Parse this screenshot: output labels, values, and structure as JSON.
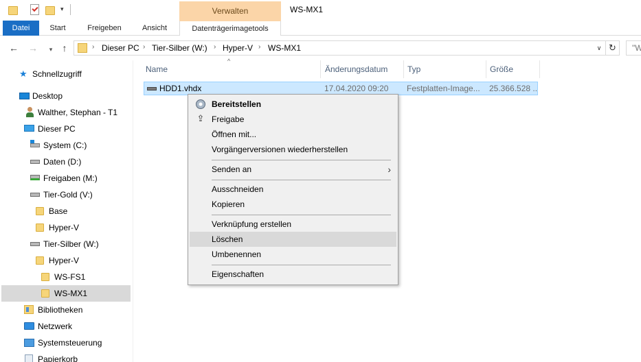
{
  "titlebar": {
    "contextual_tab_header": "Verwalten",
    "window_title": "WS-MX1",
    "qat_dropdown": "▾"
  },
  "ribbon": {
    "tabs": {
      "file": "Datei",
      "start": "Start",
      "share": "Freigeben",
      "view": "Ansicht",
      "disk_image_tools": "Datenträgerimagetools"
    },
    "accent_color": "#1a6ec5",
    "contextual_color": "#fbd5a8"
  },
  "addressbar": {
    "back": "←",
    "forward": "→",
    "recent": "▾",
    "up": "↑",
    "crumbs": [
      "Dieser PC",
      "Tier-Silber (W:)",
      "Hyper-V",
      "WS-MX1"
    ],
    "separator": "›",
    "dropdown": "∨",
    "refresh": "↻",
    "search_text": "\"W"
  },
  "nav": {
    "quick_access": "Schnellzugriff",
    "desktop": "Desktop",
    "user": "Walther, Stephan - T1",
    "this_pc": "Dieser PC",
    "system": "System (C:)",
    "data": "Daten (D:)",
    "shares": "Freigaben (M:)",
    "tier_gold": "Tier-Gold (V:)",
    "base": "Base",
    "hyperv_gold": "Hyper-V",
    "tier_silver": "Tier-Silber (W:)",
    "hyperv_silver": "Hyper-V",
    "ws_fs1": "WS-FS1",
    "ws_mx1": "WS-MX1",
    "libraries": "Bibliotheken",
    "network": "Netzwerk",
    "control_panel": "Systemsteuerung",
    "recycle_bin": "Papierkorb"
  },
  "filelist": {
    "sort_indicator": "^",
    "columns": {
      "name": "Name",
      "modified": "Änderungsdatum",
      "type": "Typ",
      "size": "Größe"
    },
    "rows": [
      {
        "name": "HDD1.vhdx",
        "modified": "17.04.2020 09:20",
        "type": "Festplatten-Image...",
        "size": "25.366.528 ..."
      }
    ]
  },
  "context_menu": {
    "mount": "Bereitstellen",
    "share": "Freigabe",
    "open_with": "Öffnen mit...",
    "restore_versions": "Vorgängerversionen wiederherstellen",
    "send_to": "Senden an",
    "send_to_arrow": "›",
    "cut": "Ausschneiden",
    "copy": "Kopieren",
    "create_shortcut": "Verknüpfung erstellen",
    "delete": "Löschen",
    "rename": "Umbenennen",
    "properties": "Eigenschaften",
    "share_icon": "⇪",
    "hovered_item": "delete"
  }
}
